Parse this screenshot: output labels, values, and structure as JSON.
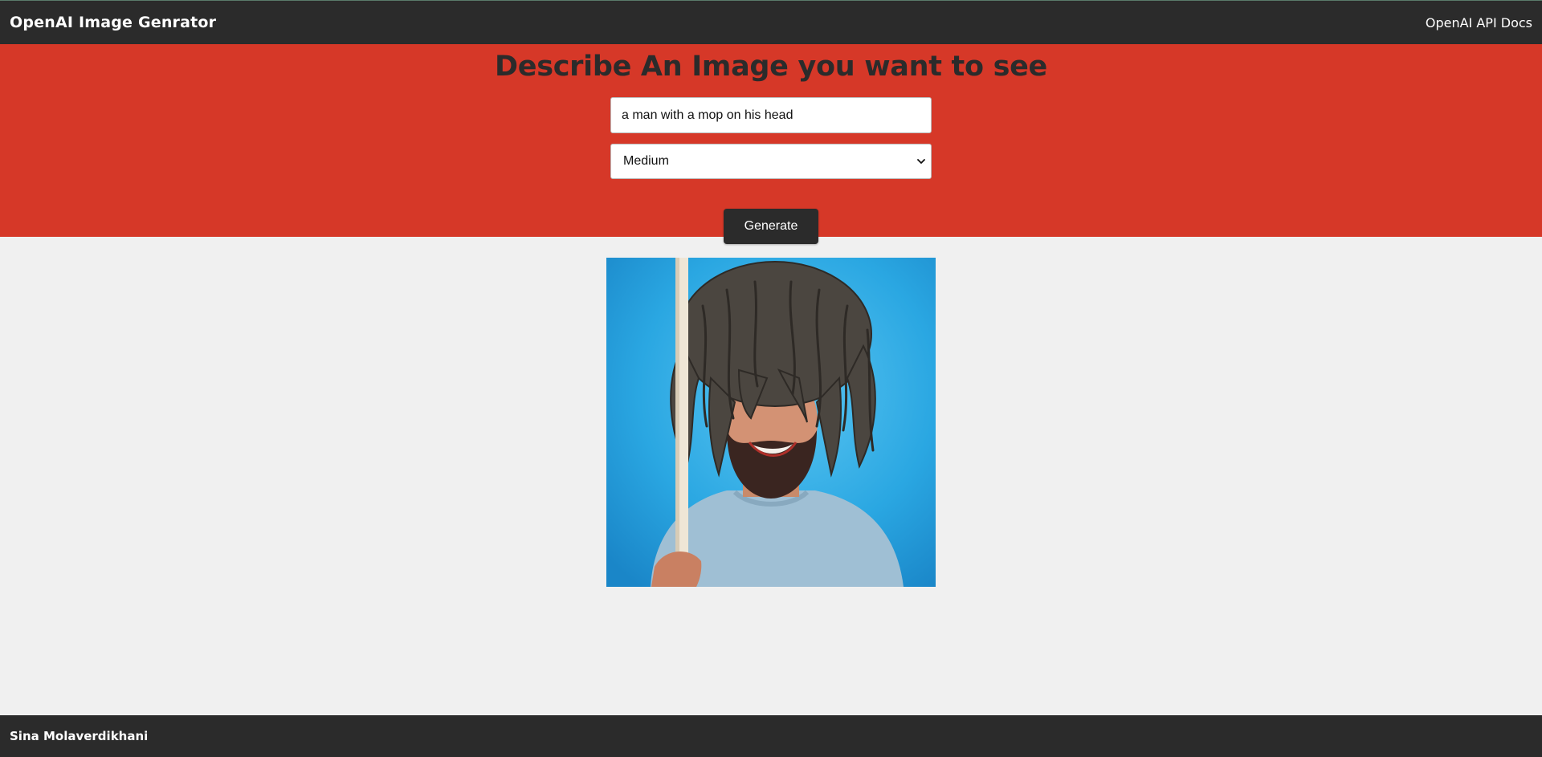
{
  "navbar": {
    "brand": "OpenAI Image Genrator",
    "docs_link": "OpenAI API Docs"
  },
  "hero": {
    "title": "Describe An Image you want to see",
    "prompt_value": "a man with a mop on his head",
    "size_selected": "Medium",
    "size_options": [
      "Medium"
    ],
    "generate_label": "Generate"
  },
  "result": {
    "image_icon": "generated-portrait"
  },
  "footer": {
    "author": "Sina Molaverdikhani"
  },
  "colors": {
    "navbar_bg": "#2b2b2b",
    "hero_bg": "#d63828",
    "page_bg": "#f0f0f0",
    "button_bg": "#2b2b2b"
  }
}
